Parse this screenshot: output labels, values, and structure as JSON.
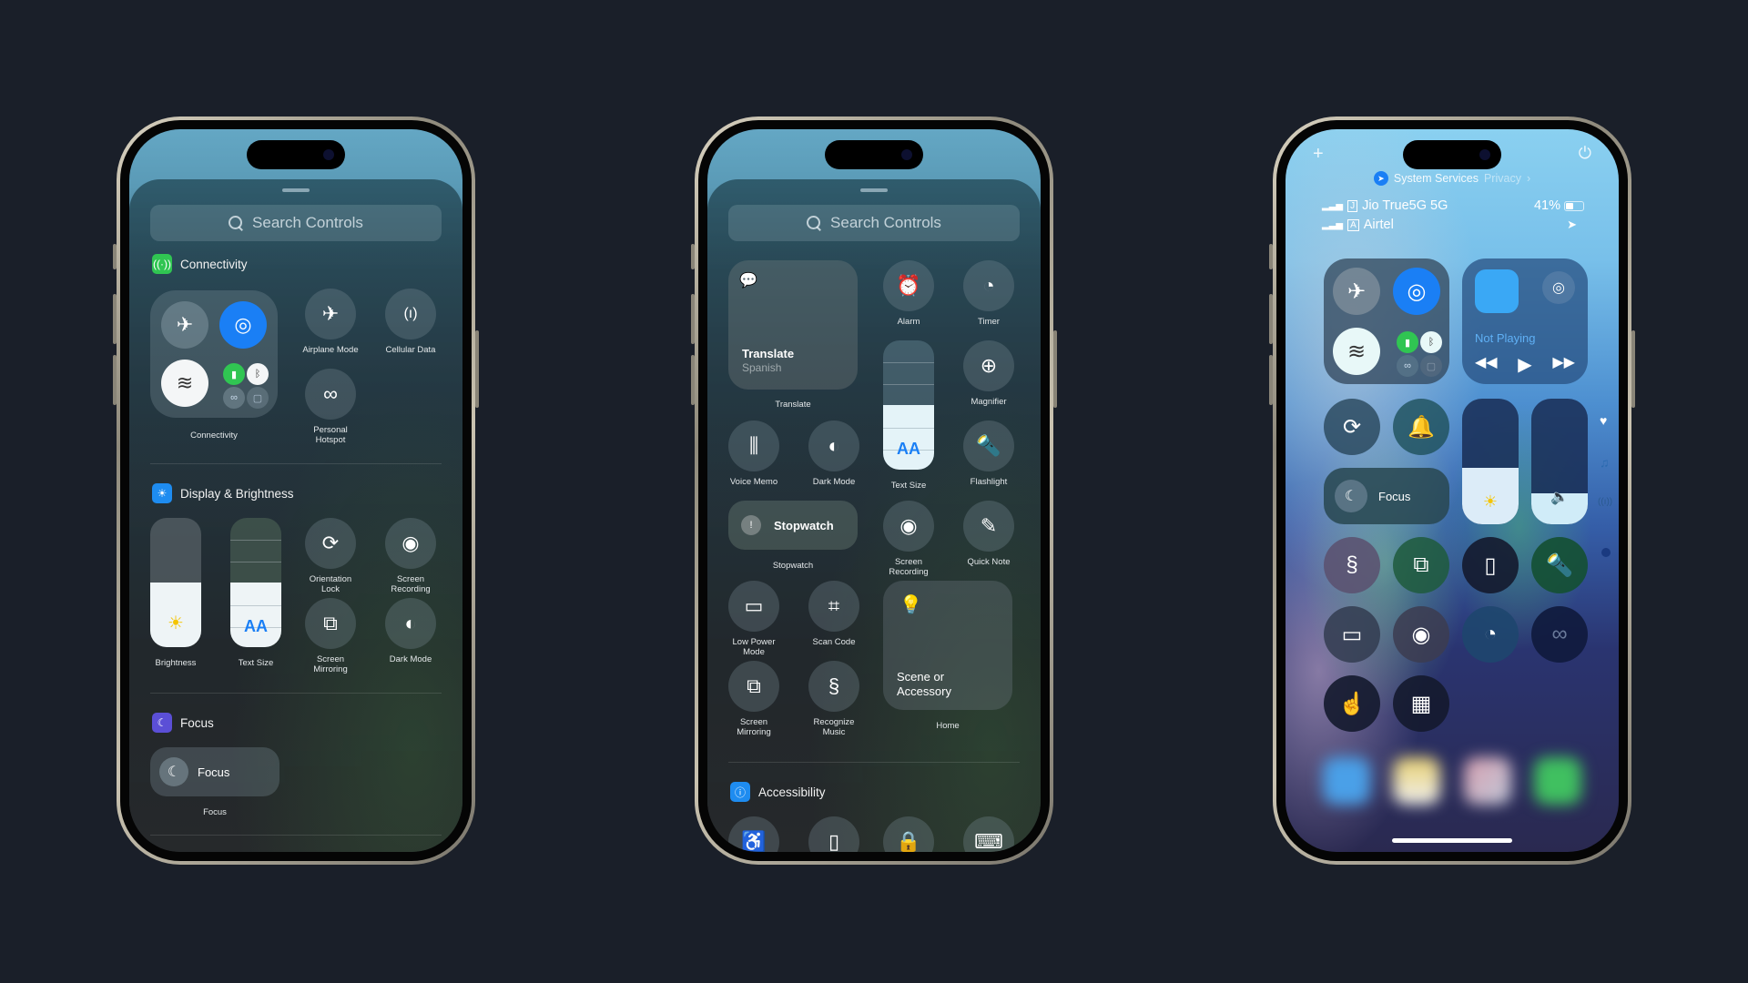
{
  "background_color": "#1a1f29",
  "phone1": {
    "search_placeholder": "Search Controls",
    "sections": {
      "connectivity": {
        "title": "Connectivity",
        "icon": "antenna-icon",
        "color": "#30c552"
      },
      "display": {
        "title": "Display & Brightness",
        "icon": "sun-icon",
        "color": "#1e8cf0"
      },
      "focus": {
        "title": "Focus",
        "icon": "moon-icon",
        "color": "#5b4fd6"
      }
    },
    "connectivity_group_label": "Connectivity",
    "airplane_mode": "Airplane Mode",
    "cellular_data": "Cellular Data",
    "personal_hotspot": "Personal\nHotspot",
    "brightness": {
      "label": "Brightness",
      "level": 0.5
    },
    "text_size": {
      "label": "Text Size",
      "glyph": "AA",
      "level": 0.5
    },
    "orientation_lock": "Orientation\nLock",
    "screen_recording": "Screen\nRecording",
    "screen_mirroring": "Screen\nMirroring",
    "dark_mode": "Dark Mode",
    "focus_tile": {
      "title": "Focus",
      "label": "Focus"
    }
  },
  "phone2": {
    "search_placeholder": "Search Controls",
    "translate": {
      "title": "Translate",
      "subtitle": "Spanish",
      "label": "Translate"
    },
    "alarm": "Alarm",
    "timer": "Timer",
    "magnifier": "Magnifier",
    "text_size": {
      "label": "Text Size",
      "glyph": "AA",
      "level": 0.5
    },
    "voice_memo": "Voice Memo",
    "dark_mode": "Dark Mode",
    "flashlight": "Flashlight",
    "stopwatch": {
      "title": "Stopwatch",
      "label": "Stopwatch"
    },
    "screen_recording": "Screen\nRecording",
    "quick_note": "Quick Note",
    "low_power_mode": "Low Power\nMode",
    "scan_code": "Scan Code",
    "home": {
      "title": "Scene or\nAccessory",
      "label": "Home"
    },
    "screen_mirroring": "Screen\nMirroring",
    "recognize_music": "Recognize\nMusic",
    "accessibility": {
      "title": "Accessibility",
      "color": "#1e8cf0"
    }
  },
  "phone3": {
    "location_banner": {
      "service": "System Services",
      "link": "Privacy"
    },
    "carrier1": "Jio True5G 5G",
    "carrier2": "Airtel",
    "battery": "41%",
    "battery_level": 0.41,
    "now_playing": "Not Playing",
    "focus_label": "Focus",
    "brightness_level": 0.45,
    "volume_level": 0.25
  }
}
